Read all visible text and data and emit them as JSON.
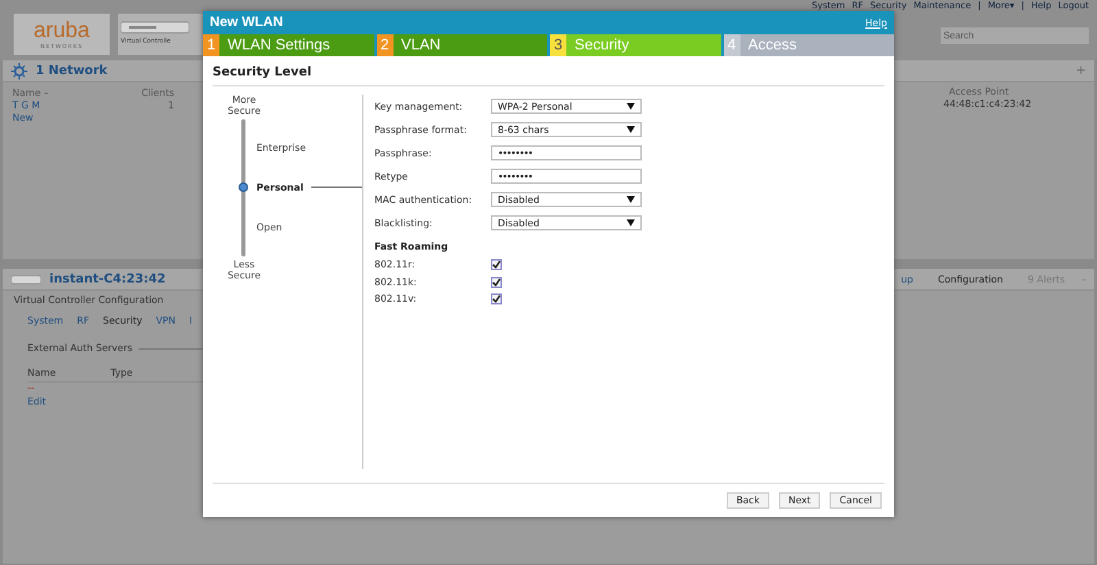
{
  "header": {
    "logo": "aruba",
    "logo_sub": "NETWORKS",
    "device_label": "Virtual Controlle",
    "nav": [
      "System",
      "RF",
      "Security",
      "Maintenance",
      "|",
      "More▾",
      "|",
      "Help",
      "Logout"
    ],
    "search": {
      "placeholder": "Search"
    }
  },
  "networks_panel": {
    "title": "1 Network",
    "add": "+",
    "columns": [
      "Name –",
      "Clients"
    ],
    "rows": [
      {
        "cells": [
          "T G M",
          "1"
        ]
      },
      {
        "cells": [
          "New"
        ]
      }
    ],
    "access_point": {
      "column": "Access Point",
      "value": "44:48:c1:c4:23:42"
    }
  },
  "device_panel": {
    "title": "instant-C4:23:42",
    "links": [
      {
        "label": "up",
        "selected": false
      },
      {
        "label": "Configuration",
        "selected": true
      }
    ],
    "alerts": "9 Alerts",
    "collapse": "–",
    "section": "Virtual Controller Configuration",
    "tabs": [
      {
        "label": "System",
        "selected": false
      },
      {
        "label": "RF",
        "selected": false
      },
      {
        "label": "Security",
        "selected": true
      },
      {
        "label": "VPN",
        "selected": false
      },
      {
        "label": "I",
        "selected": false
      }
    ],
    "auth": {
      "title": "External Auth Servers",
      "columns": [
        "Name",
        "Type"
      ],
      "rows": [
        "--"
      ],
      "link": "Edit"
    }
  },
  "dialog": {
    "title": "New WLAN",
    "help": "Help",
    "steps": [
      {
        "number": "1",
        "label": "WLAN Settings",
        "selected": false,
        "completed": true
      },
      {
        "number": "2",
        "label": "VLAN",
        "selected": false,
        "completed": true
      },
      {
        "number": "3",
        "label": "Security",
        "selected": true,
        "completed": false
      },
      {
        "number": "4",
        "label": "Access",
        "selected": false,
        "completed": false
      }
    ],
    "heading": "Security Level",
    "slider": {
      "top": "More Secure",
      "bottom": "Less Secure",
      "levels": [
        {
          "label": "Enterprise",
          "selected": false
        },
        {
          "label": "Personal",
          "selected": true
        },
        {
          "label": "Open",
          "selected": false
        }
      ]
    },
    "fields": [
      {
        "kind": "select",
        "label": "Key management:",
        "value": "WPA-2 Personal"
      },
      {
        "kind": "select",
        "label": "Passphrase format:",
        "value": "8-63 chars"
      },
      {
        "kind": "password",
        "label": "Passphrase:",
        "value": "••••••••"
      },
      {
        "kind": "password",
        "label": "Retype",
        "value": "••••••••"
      },
      {
        "kind": "select",
        "label": "MAC authentication:",
        "value": "Disabled"
      },
      {
        "kind": "select",
        "label": "Blacklisting:",
        "value": "Disabled"
      }
    ],
    "roaming": {
      "title": "Fast Roaming",
      "items": [
        {
          "label": "802.11r:",
          "checked": true
        },
        {
          "label": "802.11k:",
          "checked": true
        },
        {
          "label": "802.11v:",
          "checked": true
        }
      ]
    },
    "buttons": [
      "Back",
      "Next",
      "Cancel"
    ]
  }
}
